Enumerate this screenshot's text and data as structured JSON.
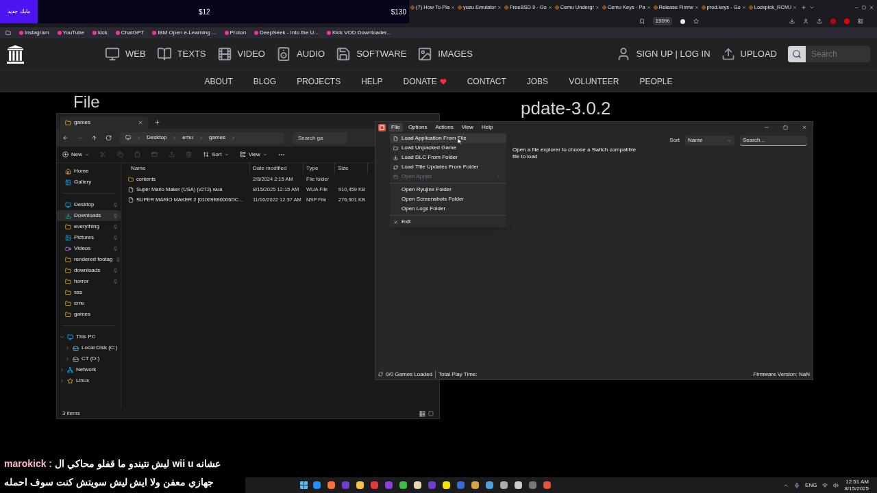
{
  "ad_banner": {
    "badge": "مايك جديد",
    "price_1": "$12",
    "price_2": "$130"
  },
  "browser": {
    "tabs": [
      {
        "label": "(7) How To Pla",
        "selected": false
      },
      {
        "label": "yuzu Emulator",
        "selected": false
      },
      {
        "label": "FreeBSD 9 - Go",
        "selected": false
      },
      {
        "label": "Cemu Undergr",
        "selected": false
      },
      {
        "label": "Cemu Keys - Pa",
        "selected": false
      },
      {
        "label": "Release Firmw",
        "selected": false
      },
      {
        "label": "prod.keys - Go",
        "selected": false
      },
      {
        "label": "Lockpick_RCM.l",
        "selected": false
      }
    ],
    "zoom": "190%",
    "bookmarks": [
      "Instagram",
      "YouTube",
      "kick",
      "ChatGPT",
      "IBM Open e-Learning ...",
      "Proton",
      "DeepSeek - Into the U...",
      "Kick VOD Downloader..."
    ]
  },
  "site_nav": {
    "items": [
      {
        "kind": "web",
        "label": "WEB"
      },
      {
        "kind": "texts",
        "label": "TEXTS"
      },
      {
        "kind": "video",
        "label": "VIDEO"
      },
      {
        "kind": "audio",
        "label": "AUDIO"
      },
      {
        "kind": "software",
        "label": "SOFTWARE"
      },
      {
        "kind": "images",
        "label": "IMAGES"
      }
    ],
    "account": "SIGN UP | LOG IN",
    "upload": "UPLOAD",
    "search_placeholder": "Search"
  },
  "sub_nav": [
    {
      "label": "ABOUT",
      "heart": false
    },
    {
      "label": "BLOG",
      "heart": false
    },
    {
      "label": "PROJECTS",
      "heart": false
    },
    {
      "label": "HELP",
      "heart": false
    },
    {
      "label": "DONATE",
      "heart": true
    },
    {
      "label": "CONTACT",
      "heart": false
    },
    {
      "label": "JOBS",
      "heart": false
    },
    {
      "label": "VOLUNTEER",
      "heart": false
    },
    {
      "label": "PEOPLE",
      "heart": false
    }
  ],
  "page_heading": {
    "left_part": "File",
    "right_part": "pdate-3.0.2"
  },
  "explorer": {
    "tab": "games",
    "path": [
      "Desktop",
      "emu",
      "games"
    ],
    "search_placeholder": "Search ga",
    "toolbar": {
      "new": "New",
      "sort": "Sort",
      "view": "View"
    },
    "columns": [
      "Name",
      "Date modified",
      "Type",
      "Size"
    ],
    "rows": [
      {
        "kind": "folder",
        "name": "contents",
        "date": "2/8/2024 2:15 AM",
        "type": "File folder",
        "size": ""
      },
      {
        "kind": "file",
        "name": "Super Mario Maker (USA) (v272).wua",
        "date": "8/15/2025 12:15 AM",
        "type": "WUA File",
        "size": "910,459 KB"
      },
      {
        "kind": "file",
        "name": "SUPER MARIO MAKER 2 [01009B90006DC...",
        "date": "11/16/2022 12:37 AM",
        "type": "NSP File",
        "size": "276,901 KB"
      }
    ],
    "quick": [
      {
        "kind": "home",
        "label": "Home",
        "pinned": false,
        "selected": false
      },
      {
        "kind": "gallery",
        "label": "Gallery",
        "pinned": false,
        "selected": false
      }
    ],
    "pinned": [
      {
        "kind": "desktop",
        "label": "Desktop",
        "pinned": true,
        "selected": false
      },
      {
        "kind": "download",
        "label": "Downloads",
        "pinned": true,
        "selected": true
      },
      {
        "kind": "folder",
        "label": "everything",
        "pinned": true,
        "selected": false
      },
      {
        "kind": "pictures",
        "label": "Pictures",
        "pinned": true,
        "selected": false
      },
      {
        "kind": "videos",
        "label": "Videos",
        "pinned": true,
        "selected": false
      },
      {
        "kind": "folder",
        "label": "rendered footag",
        "pinned": true,
        "selected": false
      },
      {
        "kind": "folder",
        "label": "downloads",
        "pinned": true,
        "selected": false
      },
      {
        "kind": "folder",
        "label": "horror",
        "pinned": true,
        "selected": false
      },
      {
        "kind": "folder",
        "label": "sss",
        "pinned": false,
        "selected": false
      },
      {
        "kind": "folder",
        "label": "emu",
        "pinned": false,
        "selected": false
      },
      {
        "kind": "folder",
        "label": "games",
        "pinned": false,
        "selected": false
      }
    ],
    "tree": [
      {
        "kind": "pc",
        "label": "This PC",
        "expanded": true,
        "children": [
          {
            "kind": "disk",
            "label": "Local Disk (C:)",
            "expanded": false
          },
          {
            "kind": "drive",
            "label": "CT (D:)",
            "expanded": false
          }
        ]
      },
      {
        "kind": "network",
        "label": "Network",
        "expanded": false
      },
      {
        "kind": "linux",
        "label": "Linux",
        "expanded": false
      }
    ],
    "status": "3 items"
  },
  "emulator": {
    "menus": [
      {
        "label": "File",
        "selected": true
      },
      {
        "label": "Options",
        "selected": false
      },
      {
        "label": "Actions",
        "selected": false
      },
      {
        "label": "View",
        "selected": false
      },
      {
        "label": "Help",
        "selected": false
      }
    ],
    "file_menu": [
      {
        "kind": "file",
        "label": "Load Application From File",
        "disabled": false,
        "hovered": true
      },
      {
        "kind": "folder",
        "label": "Load Unpacked Game",
        "disabled": false,
        "hovered": false
      },
      {
        "kind": "download",
        "label": "Load DLC From Folder",
        "disabled": false,
        "hovered": false
      },
      {
        "kind": "update",
        "label": "Load Title Updates From Folder",
        "disabled": false,
        "hovered": false
      },
      {
        "kind": "applet",
        "label": "Open Applet",
        "disabled": true,
        "hovered": false
      },
      {
        "kind": "separator"
      },
      {
        "kind": "plain",
        "label": "Open Ryujinx Folder",
        "disabled": false,
        "hovered": false
      },
      {
        "kind": "plain",
        "label": "Open Screenshots Folder",
        "disabled": false,
        "hovered": false
      },
      {
        "kind": "plain",
        "label": "Open Logs Folder",
        "disabled": false,
        "hovered": false
      },
      {
        "kind": "separator"
      },
      {
        "kind": "exit",
        "label": "Exit",
        "disabled": false,
        "hovered": false
      }
    ],
    "tooltip": "Open a file explorer to choose a Switch compatible file to load",
    "sort_label": "Sort",
    "sort_value": "Name",
    "search_placeholder": "Search...",
    "status": {
      "games": "0/0 Games Loaded",
      "play_time": "Total Play Time:",
      "firmware": "Firmware Version: NaN"
    }
  },
  "subtitle": {
    "user": "marokick :",
    "lines": [
      "عشانه wii u ليش نتيندو ما قفلو محاكي ال",
      "جهازي معفن ولا ايش ليش سويتش كنت سوف احمله"
    ]
  },
  "tray": {
    "language": "ENG",
    "time": "12:51 AM",
    "date": "8/15/2025"
  }
}
